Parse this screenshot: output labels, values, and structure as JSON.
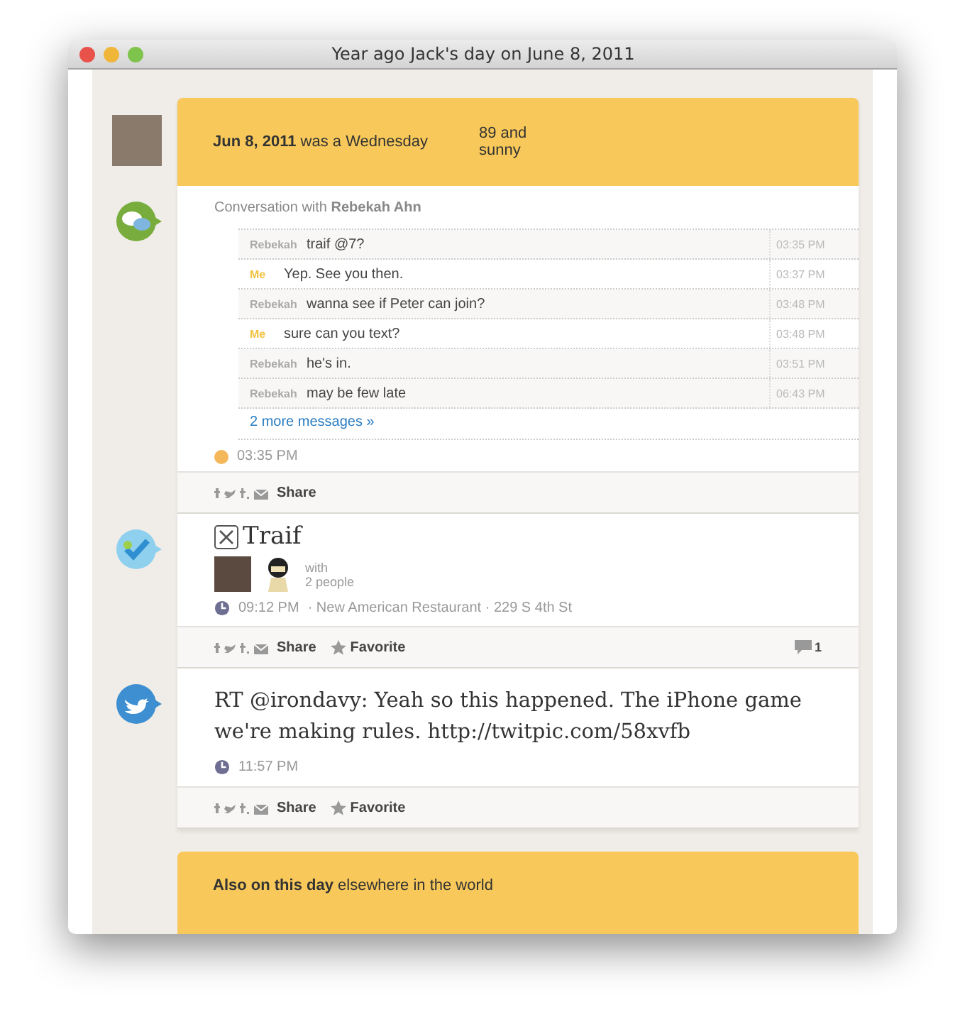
{
  "window": {
    "title": "Year ago Jack's day on June 8, 2011"
  },
  "header": {
    "date_line": "**Jun 8, 2011** was a Wednesday",
    "weather": "89 and sunny"
  },
  "feed": [
    {
      "kind": "conversation",
      "heading": "Conversation with **Rebekah Ahn**",
      "messages": [
        {
          "sender": "Rebekah",
          "kind": "them",
          "text": "traif @7?",
          "time": "03:35 PM"
        },
        {
          "sender": "Me",
          "kind": "me",
          "text": "Yep. See you then.",
          "time": "03:37 PM"
        },
        {
          "sender": "Rebekah",
          "kind": "them",
          "text": "wanna see if Peter can join?",
          "time": "03:48 PM"
        },
        {
          "sender": "Me",
          "kind": "me",
          "text": "sure can you text?",
          "time": "03:48 PM"
        },
        {
          "sender": "Rebekah",
          "kind": "them",
          "text": "he's in.",
          "time": "03:51 PM"
        },
        {
          "sender": "Rebekah",
          "kind": "them",
          "text": "may be few late",
          "time": "06:43 PM"
        }
      ],
      "more_link": "2 more messages »",
      "time": "03:35 PM",
      "share": "Share"
    },
    {
      "kind": "checkin",
      "title": "Traif",
      "with": "with",
      "people": "2 people",
      "time": "09:12 PM",
      "place": "· New American Restaurant · 229 S 4th St",
      "share": "Share",
      "favorite": "Favorite",
      "comments": "1"
    },
    {
      "kind": "tweet",
      "text": "RT @irondavy: Yeah so this happened. The iPhone game we're making rules. http://twitpic.com/58xvfb",
      "time": "11:57 PM",
      "share": "Share",
      "favorite": "Favorite"
    }
  ],
  "also": {
    "text": "**Also on this day** elsewhere in the world"
  }
}
